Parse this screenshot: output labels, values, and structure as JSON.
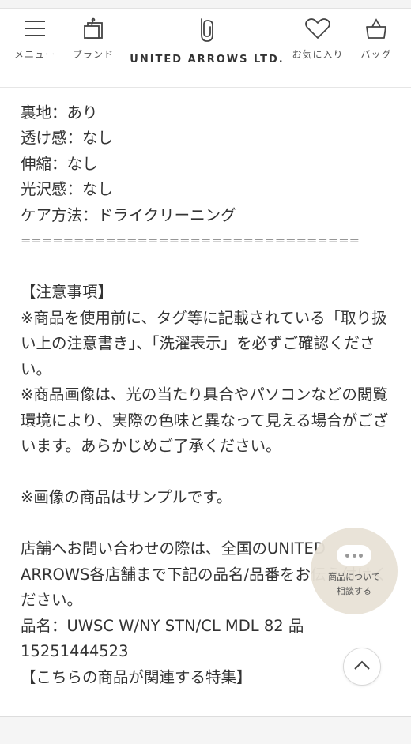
{
  "header": {
    "menu_label": "メニュー",
    "brand_label": "ブランド",
    "logo_text": "UNITED ARROWS LTD.",
    "favorites_label": "お気に入り",
    "bag_label": "バッグ"
  },
  "content": {
    "rule": "================================",
    "spec_lines": [
      "裏地：あり",
      "透け感：なし",
      "伸縮：なし",
      "光沢感：なし",
      "ケア方法：ドライクリーニング"
    ],
    "notes_heading": "【注意事項】",
    "note_1": "※商品を使用前に、タグ等に記載されている「取り扱い上の注意書き」、「洗濯表示」を必ずご確認ください。",
    "note_2": "※商品画像は、光の当たり具合やパソコンなどの閲覧環境により、実際の色味と異なって見える場合がございます。あらかじめご了承ください。",
    "sample_note": "※画像の商品はサンプルです。",
    "store_inquiry": "店舗へお問い合わせの際は、全国のUNITED ARROWS各店舗まで下記の品名/品番をお伝え付けください。",
    "product_name": "品名：UWSC W/NY STN/CL MDL 82 品",
    "product_number": "15251444523",
    "related_feature": "【こちらの商品が関連する特集】"
  },
  "floating": {
    "consult_line1": "商品について",
    "consult_line2": "相談する"
  }
}
